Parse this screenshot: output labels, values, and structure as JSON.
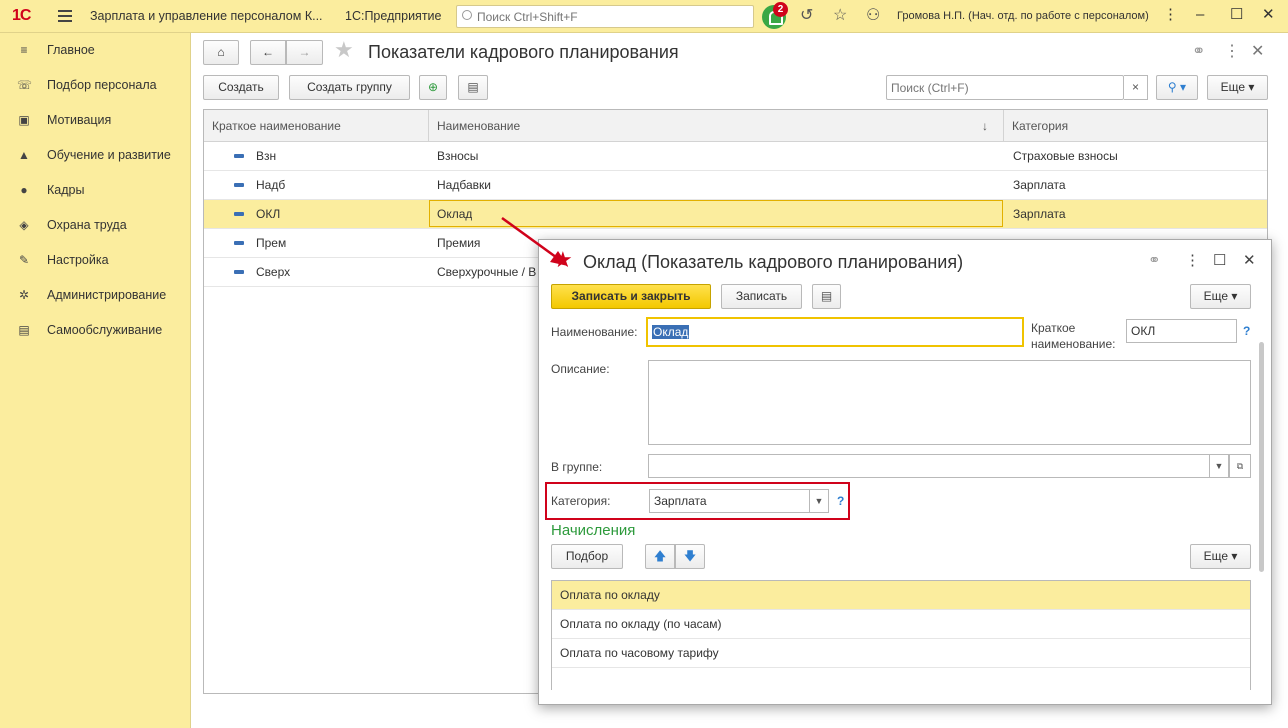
{
  "topbar": {
    "logo": "1С",
    "app_title": "Зарплата и управление персоналом К...",
    "platform": "1С:Предприятие",
    "search_placeholder": "Поиск Ctrl+Shift+F",
    "notification_count": "2",
    "user": "Громова Н.П. (Нач. отд. по работе с персоналом)"
  },
  "sidebar": {
    "items": [
      {
        "label": "Главное",
        "icon": "menu-lines-icon"
      },
      {
        "label": "Подбор персонала",
        "icon": "phone-icon"
      },
      {
        "label": "Мотивация",
        "icon": "gift-icon"
      },
      {
        "label": "Обучение и развитие",
        "icon": "graduation-cap-icon"
      },
      {
        "label": "Кадры",
        "icon": "people-icon"
      },
      {
        "label": "Охрана труда",
        "icon": "shield-icon"
      },
      {
        "label": "Настройка",
        "icon": "wrench-icon"
      },
      {
        "label": "Администрирование",
        "icon": "gear-icon"
      },
      {
        "label": "Самообслуживание",
        "icon": "card-icon"
      }
    ]
  },
  "list": {
    "title": "Показатели кадрового планирования",
    "create_label": "Создать",
    "create_group_label": "Создать группу",
    "search_placeholder": "Поиск (Ctrl+F)",
    "clear_label": "×",
    "more_label": "Еще",
    "columns": [
      "Краткое наименование",
      "Наименование",
      "Категория"
    ],
    "sort_indicator": "↓",
    "rows": [
      {
        "short": "Взн",
        "name": "Взносы",
        "category": "Страховые взносы"
      },
      {
        "short": "Надб",
        "name": "Надбавки",
        "category": "Зарплата"
      },
      {
        "short": "ОКЛ",
        "name": "Оклад",
        "category": "Зарплата"
      },
      {
        "short": "Прем",
        "name": "Премия",
        "category": ""
      },
      {
        "short": "Сверх",
        "name": "Сверхурочные / В",
        "category": ""
      }
    ]
  },
  "dialog": {
    "title": "Оклад (Показатель кадрового планирования)",
    "save_close_label": "Записать и закрыть",
    "save_label": "Записать",
    "more_label": "Еще",
    "name_label": "Наименование:",
    "name_value": "Оклад",
    "short_label_1": "Краткое",
    "short_label_2": "наименование:",
    "short_value": "ОКЛ",
    "description_label": "Описание:",
    "group_label": "В группе:",
    "group_value": "",
    "category_label": "Категория:",
    "category_value": "Зарплата",
    "help": "?",
    "accruals_title": "Начисления",
    "pick_label": "Подбор",
    "accruals_more_label": "Еще",
    "accruals": [
      "Оплата по окладу",
      "Оплата по окладу (по часам)",
      "Оплата по часовому тарифу"
    ]
  },
  "colors": {
    "accent_yellow": "#fbed9e",
    "primary_button": "#f3c800",
    "highlight_red": "#d0021b",
    "section_green": "#2d9a3c"
  }
}
